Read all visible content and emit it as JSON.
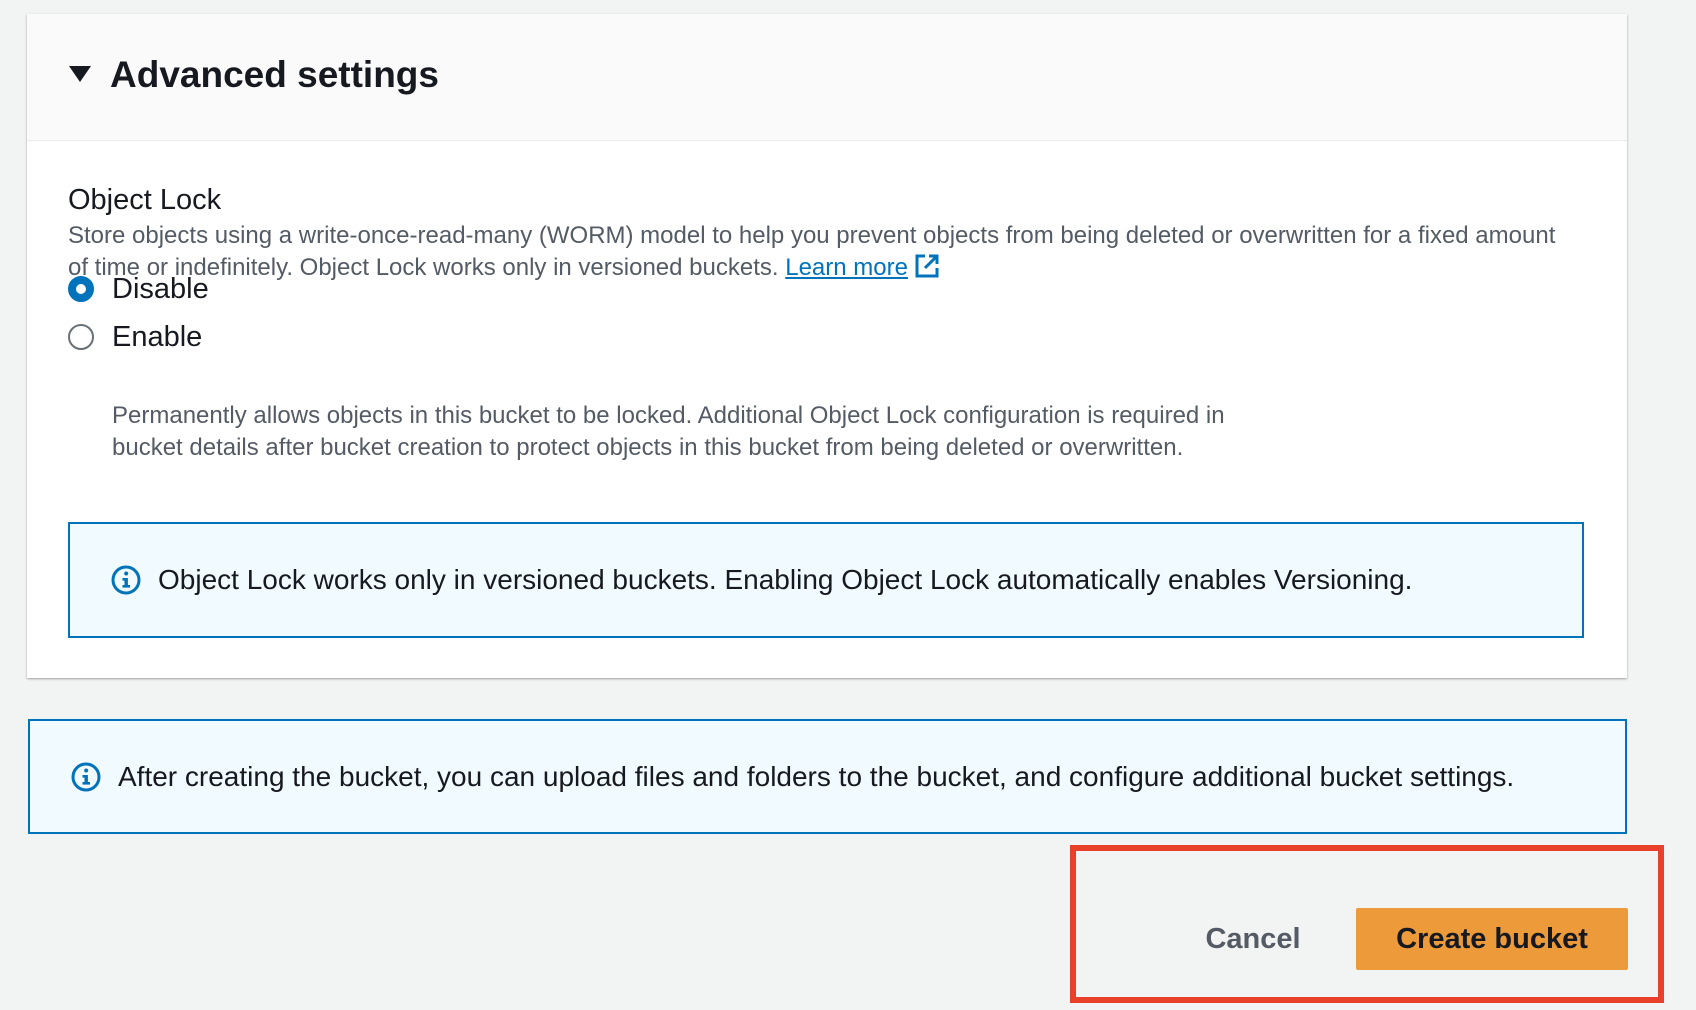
{
  "panel": {
    "title": "Advanced settings",
    "expanded": true
  },
  "object_lock": {
    "label": "Object Lock",
    "description": "Store objects using a write-once-read-many (WORM) model to help you prevent objects from being deleted or overwritten for a fixed amount of time or indefinitely. Object Lock works only in versioned buckets.",
    "learn_more": "Learn more",
    "options": [
      {
        "label": "Disable",
        "selected": true
      },
      {
        "label": "Enable",
        "selected": false,
        "description": "Permanently allows objects in this bucket to be locked. Additional Object Lock configuration is required in bucket details after bucket creation to protect objects in this bucket from being deleted or overwritten."
      }
    ],
    "info": "Object Lock works only in versioned buckets. Enabling Object Lock automatically enables Versioning."
  },
  "footer_info": "After creating the bucket, you can upload files and folders to the bucket, and configure additional bucket settings.",
  "actions": {
    "cancel": "Cancel",
    "create": "Create bucket"
  },
  "colors": {
    "accent": "#0073bb",
    "primary_button": "#ec9a3a",
    "highlight": "#e8402b",
    "info_background": "#f1faff"
  }
}
